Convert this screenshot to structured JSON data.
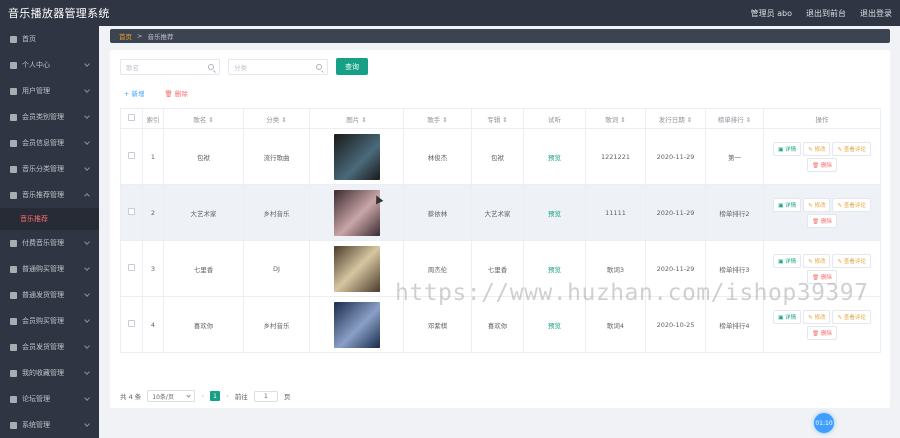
{
  "header": {
    "title": "音乐播放器管理系统",
    "nav": [
      "管理员 abo",
      "退出到前台",
      "退出登录"
    ]
  },
  "sidebar": {
    "items": [
      {
        "label": "首页",
        "icon": "home-icon",
        "chevron": false
      },
      {
        "label": "个人中心",
        "icon": "user-icon",
        "chevron": true
      },
      {
        "label": "用户管理",
        "icon": "users-icon",
        "chevron": true
      },
      {
        "label": "会员类别管理",
        "icon": "chart-icon",
        "chevron": true
      },
      {
        "label": "会员信息管理",
        "icon": "grid-icon",
        "chevron": true
      },
      {
        "label": "音乐分类管理",
        "icon": "user-icon",
        "chevron": true
      },
      {
        "label": "音乐推荐管理",
        "icon": "flag-icon",
        "chevron": true,
        "expanded": true
      }
    ],
    "active_sub": "音乐推荐",
    "items_after": [
      {
        "label": "付费音乐管理",
        "icon": "music-icon"
      },
      {
        "label": "普通购买管理",
        "icon": "cart-icon"
      },
      {
        "label": "普通发货管理",
        "icon": "truck-icon"
      },
      {
        "label": "会员购买管理",
        "icon": "cart-icon"
      },
      {
        "label": "会员发货管理",
        "icon": "box-icon"
      },
      {
        "label": "我的收藏管理",
        "icon": "star-icon"
      },
      {
        "label": "论坛管理",
        "icon": "chat-icon"
      },
      {
        "label": "系统管理",
        "icon": "gear-icon"
      }
    ]
  },
  "breadcrumb": {
    "home": "首页",
    "separator": ">",
    "current": "音乐推荐"
  },
  "search": {
    "song_placeholder": "歌名",
    "category_placeholder": "分类",
    "query_label": "查询"
  },
  "toolbar": {
    "add_label": "+ 新增",
    "delete_label": "删除"
  },
  "table": {
    "headers": [
      "索引",
      "歌名 ⇕",
      "分类 ⇕",
      "图片 ⇕",
      "歌手 ⇕",
      "专辑 ⇕",
      "试听",
      "歌词 ⇕",
      "发行日期 ⇕",
      "榜单排行 ⇕",
      "操作"
    ],
    "rows": [
      {
        "index": "1",
        "song": "包袱",
        "category": "流行歌曲",
        "singer": "林俊杰",
        "album": "包袱",
        "preview": "预览",
        "lyrics": "1221221",
        "date": "2020-11-29",
        "rank": "第一",
        "cover": [
          "#1a1a1a",
          "#4a6a7a"
        ]
      },
      {
        "index": "2",
        "song": "大艺术家",
        "category": "乡村音乐",
        "singer": "蔡依林",
        "album": "大艺术家",
        "preview": "预览",
        "lyrics": "11111",
        "date": "2020-11-29",
        "rank": "榜单排行2",
        "cover": [
          "#3a2a30",
          "#c9a6a8"
        ]
      },
      {
        "index": "3",
        "song": "七里香",
        "category": "DJ",
        "singer": "周杰伦",
        "album": "七里香",
        "preview": "预览",
        "lyrics": "歌词3",
        "date": "2020-11-29",
        "rank": "榜单排行3",
        "cover": [
          "#4a3a2a",
          "#d6c6a0"
        ]
      },
      {
        "index": "4",
        "song": "喜欢你",
        "category": "乡村音乐",
        "singer": "邓紫棋",
        "album": "喜欢你",
        "preview": "预览",
        "lyrics": "歌词4",
        "date": "2020-10-25",
        "rank": "榜单排行4",
        "cover": [
          "#1a2a4a",
          "#8aa0c8"
        ]
      }
    ],
    "ops": {
      "detail": "详情",
      "edit": "修改",
      "review": "查看评论",
      "delete": "删除"
    }
  },
  "pagination": {
    "total": "共 4 条",
    "page_size": "10条/页",
    "prev": "‹",
    "current": "1",
    "next": "›",
    "goto_label": "前往",
    "goto_value": "1",
    "page_unit": "页"
  },
  "watermark": "https://www.huzhan.com/ishop39397",
  "float_button": "01:10",
  "colors": {
    "primary": "#16a085",
    "sidebar_bg": "#2f3542",
    "active": "#ff6b6b"
  }
}
